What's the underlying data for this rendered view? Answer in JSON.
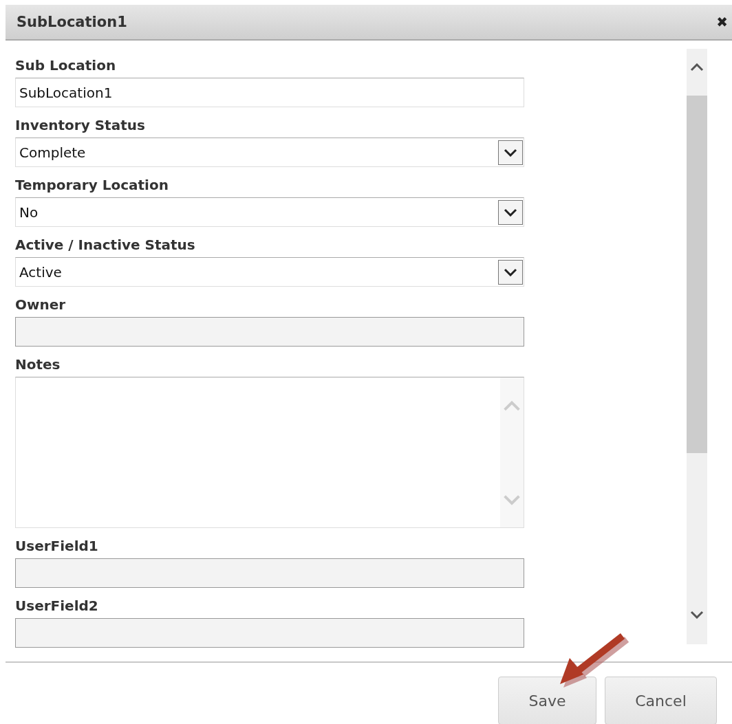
{
  "dialog": {
    "title": "SubLocation1",
    "close": "✖"
  },
  "fields": [
    {
      "label": "Sub Location",
      "kind": "text",
      "value": "SubLocation1",
      "disabled": false
    },
    {
      "label": "Inventory Status",
      "kind": "select",
      "value": "Complete"
    },
    {
      "label": "Temporary Location",
      "kind": "select",
      "value": "No"
    },
    {
      "label": "Active / Inactive Status",
      "kind": "select",
      "value": "Active"
    },
    {
      "label": "Owner",
      "kind": "text",
      "disabled": true
    },
    {
      "label": "Notes",
      "kind": "textarea"
    },
    {
      "label": "UserField1",
      "kind": "text",
      "disabled": true
    },
    {
      "label": "UserField2",
      "kind": "text",
      "disabled": true
    }
  ],
  "buttons": [
    {
      "label": "Save"
    },
    {
      "label": "Cancel"
    }
  ]
}
